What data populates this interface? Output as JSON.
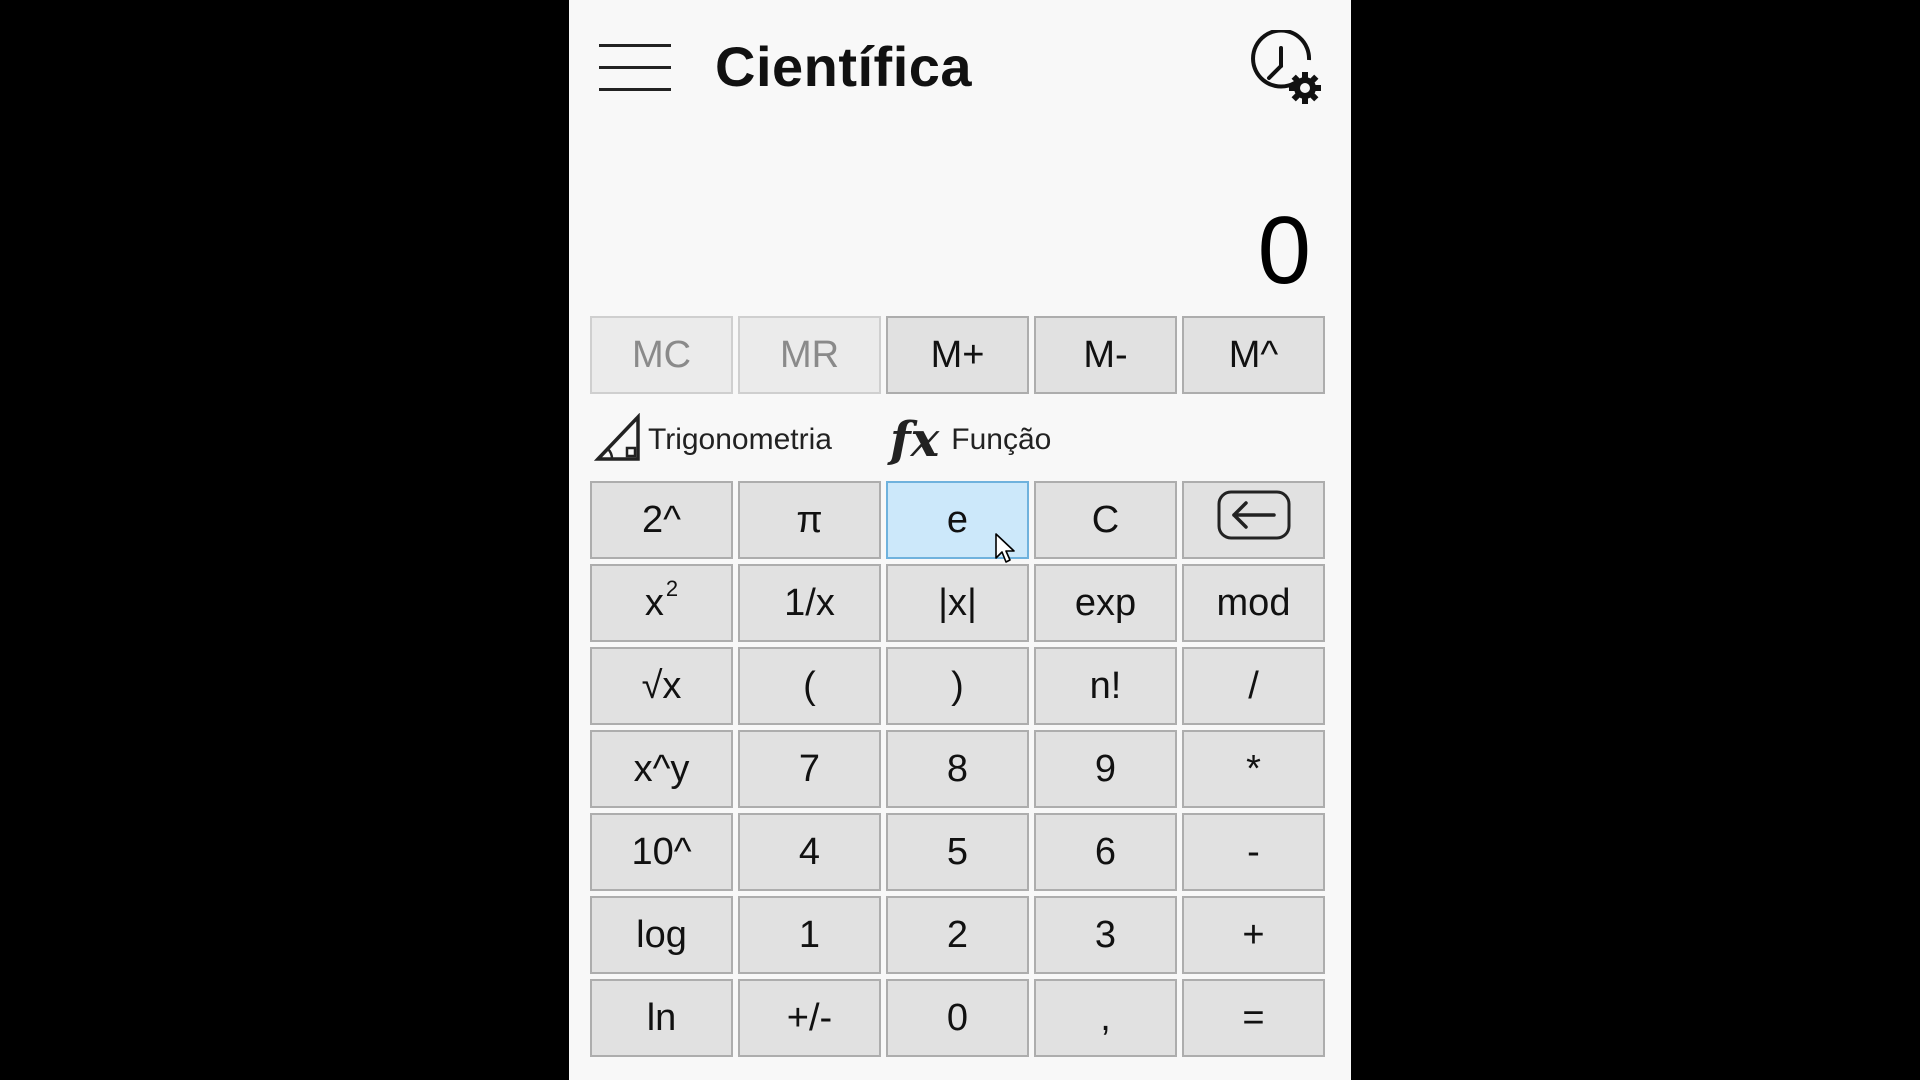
{
  "header": {
    "title": "Científica",
    "menu_icon": "hamburger-menu-icon",
    "history_icon": "history-settings-icon"
  },
  "display": {
    "value": "0"
  },
  "memory": {
    "mc": "MC",
    "mr": "MR",
    "mplus": "M+",
    "mminus": "M-",
    "mcaret": "M^"
  },
  "functions": {
    "trig_label": "Trigonometria",
    "trig_icon": "triangle-ruler-icon",
    "func_glyph": "fx",
    "func_label": "Função"
  },
  "keys": {
    "pow2": "2^",
    "pi": "π",
    "e": "e",
    "clear": "C",
    "backspace_icon": "backspace-arrow-icon",
    "square_base": "x",
    "square_exp": "2",
    "reciprocal": "1/x",
    "abs": "|x|",
    "exp": "exp",
    "mod": "mod",
    "sqrt": "√x",
    "lparen": "(",
    "rparen": ")",
    "factorial": "n!",
    "divide": "/",
    "xpowy": "x^y",
    "d7": "7",
    "d8": "8",
    "d9": "9",
    "multiply": "*",
    "pow10": "10^",
    "d4": "4",
    "d5": "5",
    "d6": "6",
    "minus": "-",
    "log": "log",
    "d1": "1",
    "d2": "2",
    "d3": "3",
    "plus": "+",
    "ln": "ln",
    "negate": "+/-",
    "d0": "0",
    "decimal": ",",
    "equals": "="
  },
  "colors": {
    "background": "#000000",
    "app_bg": "#f8f8f8",
    "key_bg": "#e1e1e1",
    "key_hover_bg": "#cce8fa",
    "disabled_text": "#8a8a8a"
  }
}
